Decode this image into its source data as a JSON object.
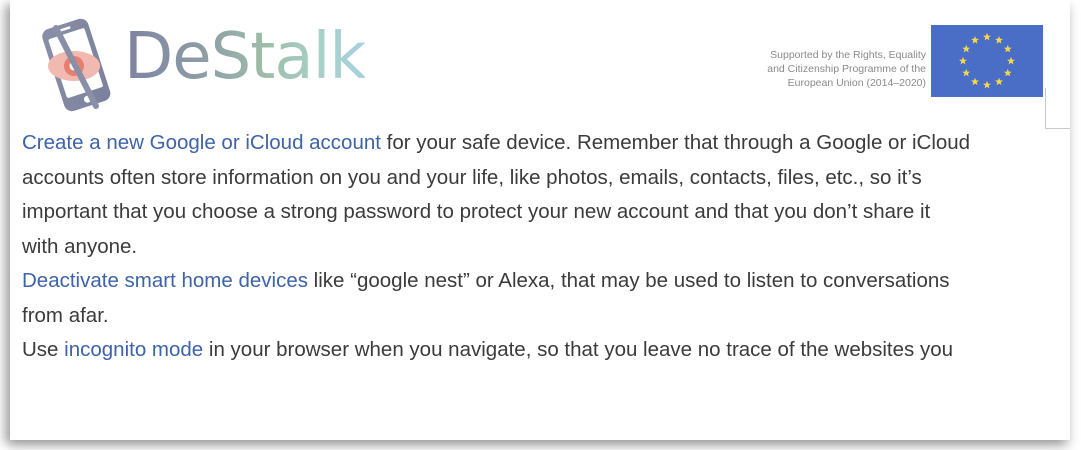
{
  "header": {
    "brand": "DeStalk",
    "support_lines": [
      "Supported by the Rights, Equality",
      "and Citizenship Programme of the",
      "European Union (2014–2020)"
    ]
  },
  "colors": {
    "link": "#3d63a8",
    "text": "#3b3b3b",
    "flag_blue": "#4a6ec5",
    "flag_star": "#f5d84a"
  },
  "icons": {
    "logo": "phone-eye-logo-icon",
    "flag": "eu-flag-icon"
  },
  "paragraphs": [
    {
      "lines": [
        [
          {
            "link": "Create a new Google or iCloud account"
          },
          {
            "text": " for your safe device. Remember that through a Google or iCloud"
          }
        ],
        [
          {
            "text": "accounts often store information on you and your life, like photos, emails, contacts, files, etc., so it’s"
          }
        ],
        [
          {
            "text": "important that you choose a strong password to protect your new account and that you don’t share it"
          }
        ],
        [
          {
            "text": "with anyone."
          }
        ]
      ]
    },
    {
      "lines": [
        [
          {
            "link": "Deactivate smart home devices"
          },
          {
            "text": " like “google nest” or Alexa, that may be used to listen to conversations"
          }
        ],
        [
          {
            "text": "from afar."
          }
        ]
      ]
    },
    {
      "lines": [
        [
          {
            "text": "Use "
          },
          {
            "link": "incognito mode"
          },
          {
            "text": " in your browser when you navigate, so that you leave no trace of the websites you"
          }
        ]
      ]
    }
  ]
}
